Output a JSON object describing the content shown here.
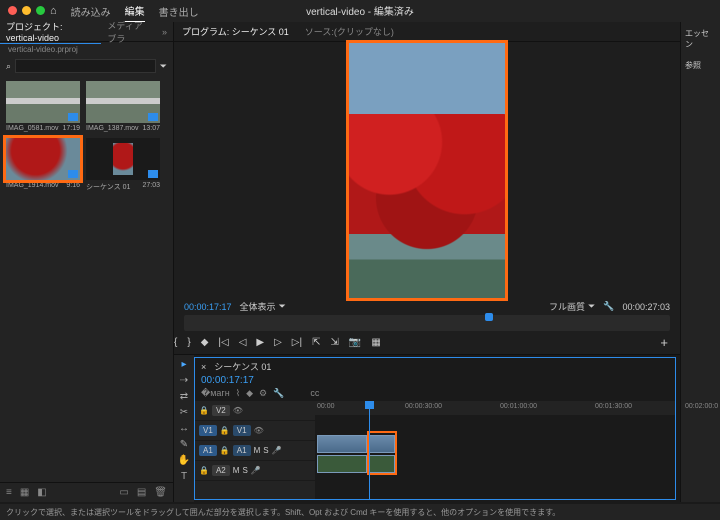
{
  "window": {
    "title": "vertical-video - 編集済み"
  },
  "top_tabs": {
    "home_icon": "⌂",
    "import": "読み込み",
    "edit": "編集",
    "export": "書き出し"
  },
  "project_panel": {
    "tab_label": "プロジェクト: vertical-video",
    "media_tab": "メディアブラ",
    "project_file": "vertical-video.prproj",
    "search_placeholder": "",
    "bins": [
      {
        "name": "IMAG_0581.mov",
        "dur": "17:19"
      },
      {
        "name": "IMAG_1387.mov",
        "dur": "13:07"
      },
      {
        "name": "IMAG_1914.mov",
        "dur": "9:16"
      },
      {
        "name": "シーケンス 01",
        "dur": "27:03"
      }
    ]
  },
  "program": {
    "tab": "プログラム: シーケンス 01",
    "source_tab": "ソース:(クリップなし)",
    "timecode": "00:00:17:17",
    "fit_label": "全体表示",
    "quality_label": "フル画質",
    "duration": "00:00:27:03"
  },
  "timeline": {
    "seq_name": "シーケンス 01",
    "timecode": "00:00:17:17",
    "ruler": [
      "00:00",
      "00:00:30:00",
      "00:01:00:00",
      "00:01:30:00",
      "00:02:00:0"
    ],
    "tracks": {
      "v2": "V2",
      "v1": "V1",
      "a1": "A1",
      "a2": "A2",
      "v1_tag": "V1",
      "a1_tag": "A1"
    }
  },
  "right_panel": {
    "essentials": "エッセン",
    "ref": "参照"
  },
  "status": "クリックで選択、または選択ツールをドラッグして囲んだ部分を選択します。Shift、Opt および Cmd キーを使用すると、他のオプションを使用できます。"
}
